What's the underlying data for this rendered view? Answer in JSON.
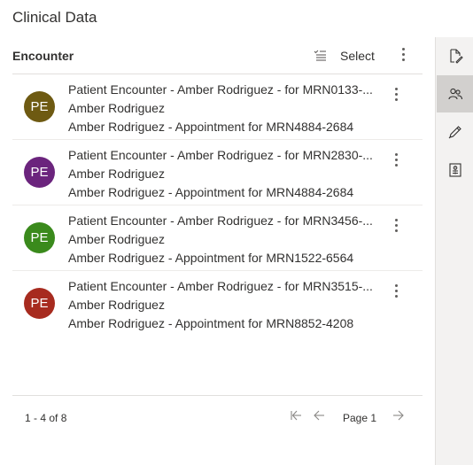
{
  "page": {
    "title": "Clinical Data"
  },
  "header": {
    "title": "Encounter",
    "select_label": "Select",
    "select_icon": "select-list-icon",
    "more_icon": "more-vertical-icon"
  },
  "records": [
    {
      "initials": "PE",
      "color": "#6e5a12",
      "line1": "Patient Encounter - Amber Rodriguez - for MRN0133-...",
      "line2": "Amber Rodriguez",
      "line3": "Amber Rodriguez - Appointment for MRN4884-2684"
    },
    {
      "initials": "PE",
      "color": "#6b247d",
      "line1": "Patient Encounter - Amber Rodriguez - for MRN2830-...",
      "line2": "Amber Rodriguez",
      "line3": "Amber Rodriguez - Appointment for MRN4884-2684"
    },
    {
      "initials": "PE",
      "color": "#3a8a1c",
      "line1": "Patient Encounter - Amber Rodriguez - for MRN3456-...",
      "line2": "Amber Rodriguez",
      "line3": "Amber Rodriguez - Appointment for MRN1522-6564"
    },
    {
      "initials": "PE",
      "color": "#a72b1f",
      "line1": "Patient Encounter - Amber Rodriguez - for MRN3515-...",
      "line2": "Amber Rodriguez",
      "line3": "Amber Rodriguez - Appointment for MRN8852-4208"
    }
  ],
  "footer": {
    "count": "1 - 4 of 8",
    "page_label": "Page 1",
    "first_icon": "first-page-icon",
    "prev_icon": "previous-page-icon",
    "next_icon": "next-page-icon"
  },
  "rail": [
    {
      "icon": "document-edit-icon",
      "active": false
    },
    {
      "icon": "people-icon",
      "active": true
    },
    {
      "icon": "pen-icon",
      "active": false
    },
    {
      "icon": "contact-card-icon",
      "active": false
    }
  ]
}
